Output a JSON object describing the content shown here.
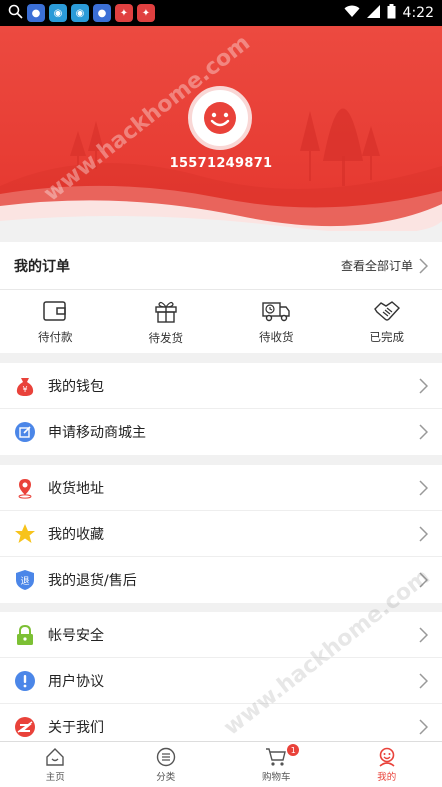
{
  "status_bar": {
    "time": "4:22"
  },
  "profile": {
    "phone": "15571249871"
  },
  "orders": {
    "title": "我的订单",
    "view_all": "查看全部订单",
    "statuses": [
      {
        "label": "待付款",
        "icon": "wallet-icon"
      },
      {
        "label": "待发货",
        "icon": "gift-icon"
      },
      {
        "label": "待收货",
        "icon": "truck-icon"
      },
      {
        "label": "已完成",
        "icon": "handshake-icon"
      }
    ]
  },
  "menu": {
    "group1": [
      {
        "label": "我的钱包",
        "icon": "money-bag-icon",
        "color": "#e9423a"
      },
      {
        "label": "申请移动商城主",
        "icon": "edit-icon",
        "color": "#4b86e8"
      }
    ],
    "group2": [
      {
        "label": "收货地址",
        "icon": "location-pin-icon",
        "color": "#e9423a"
      },
      {
        "label": "我的收藏",
        "icon": "star-icon",
        "color": "#f7c31b"
      },
      {
        "label": "我的退货/售后",
        "icon": "return-shield-icon",
        "color": "#4b86e8"
      }
    ],
    "group3": [
      {
        "label": "帐号安全",
        "icon": "lock-icon",
        "color": "#7cc034"
      },
      {
        "label": "用户协议",
        "icon": "info-icon",
        "color": "#4b86e8"
      },
      {
        "label": "关于我们",
        "icon": "about-logo-icon",
        "color": "#e9423a"
      }
    ]
  },
  "tabbar": {
    "tabs": [
      {
        "label": "主页",
        "icon": "home-icon"
      },
      {
        "label": "分类",
        "icon": "category-icon"
      },
      {
        "label": "购物车",
        "icon": "cart-icon",
        "badge": "1"
      },
      {
        "label": "我的",
        "icon": "profile-icon",
        "active": true
      }
    ]
  },
  "watermark": "www.hackhome.com",
  "colors": {
    "accent": "#e9423a",
    "blue": "#4b86e8",
    "yellow": "#f7c31b",
    "green": "#7cc034"
  }
}
